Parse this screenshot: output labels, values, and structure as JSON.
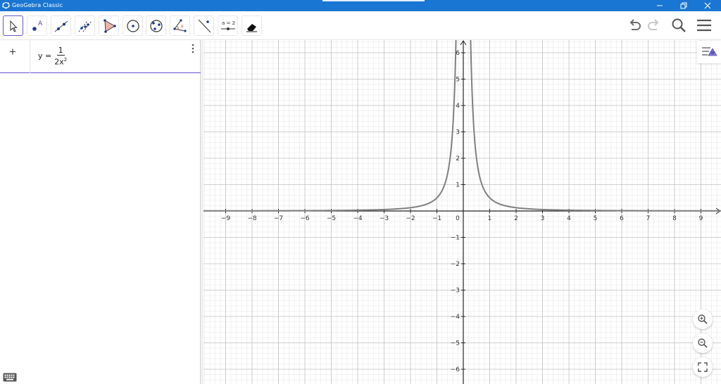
{
  "window": {
    "title": "GeoGebra Classic"
  },
  "toolbar": {
    "tools": [
      "move-tool",
      "point-tool",
      "line-tool",
      "parallel-line-tool",
      "polygon-tool",
      "circle-center-point-tool",
      "circle-three-points-tool",
      "angle-tool",
      "reflect-tool",
      "slider-tool",
      "delete-tool"
    ],
    "slider_label": "a = 2"
  },
  "algebra": {
    "input_icon": "+",
    "formula": {
      "lhs": "y =",
      "numerator": "1",
      "denominator": "2x",
      "exponent": "2"
    }
  },
  "graph": {
    "x_ticks": [
      "−9",
      "−8",
      "−7",
      "−6",
      "−5",
      "−4",
      "−3",
      "−2",
      "−1",
      "0",
      "1",
      "2",
      "3",
      "4",
      "5",
      "6",
      "7",
      "8",
      "9"
    ],
    "y_ticks_pos": [
      "1",
      "2",
      "3",
      "4",
      "5",
      "6"
    ],
    "y_ticks_neg": [
      "−1",
      "−2",
      "−3",
      "−4",
      "−5",
      "−6"
    ],
    "curve_color": "#808080",
    "axis_color": "#252525",
    "grid_major_color": "#c0c0c0",
    "grid_minor_color": "#e8e8e8"
  },
  "colors": {
    "titlebar": "#1976d2",
    "accent": "#6557d2"
  }
}
